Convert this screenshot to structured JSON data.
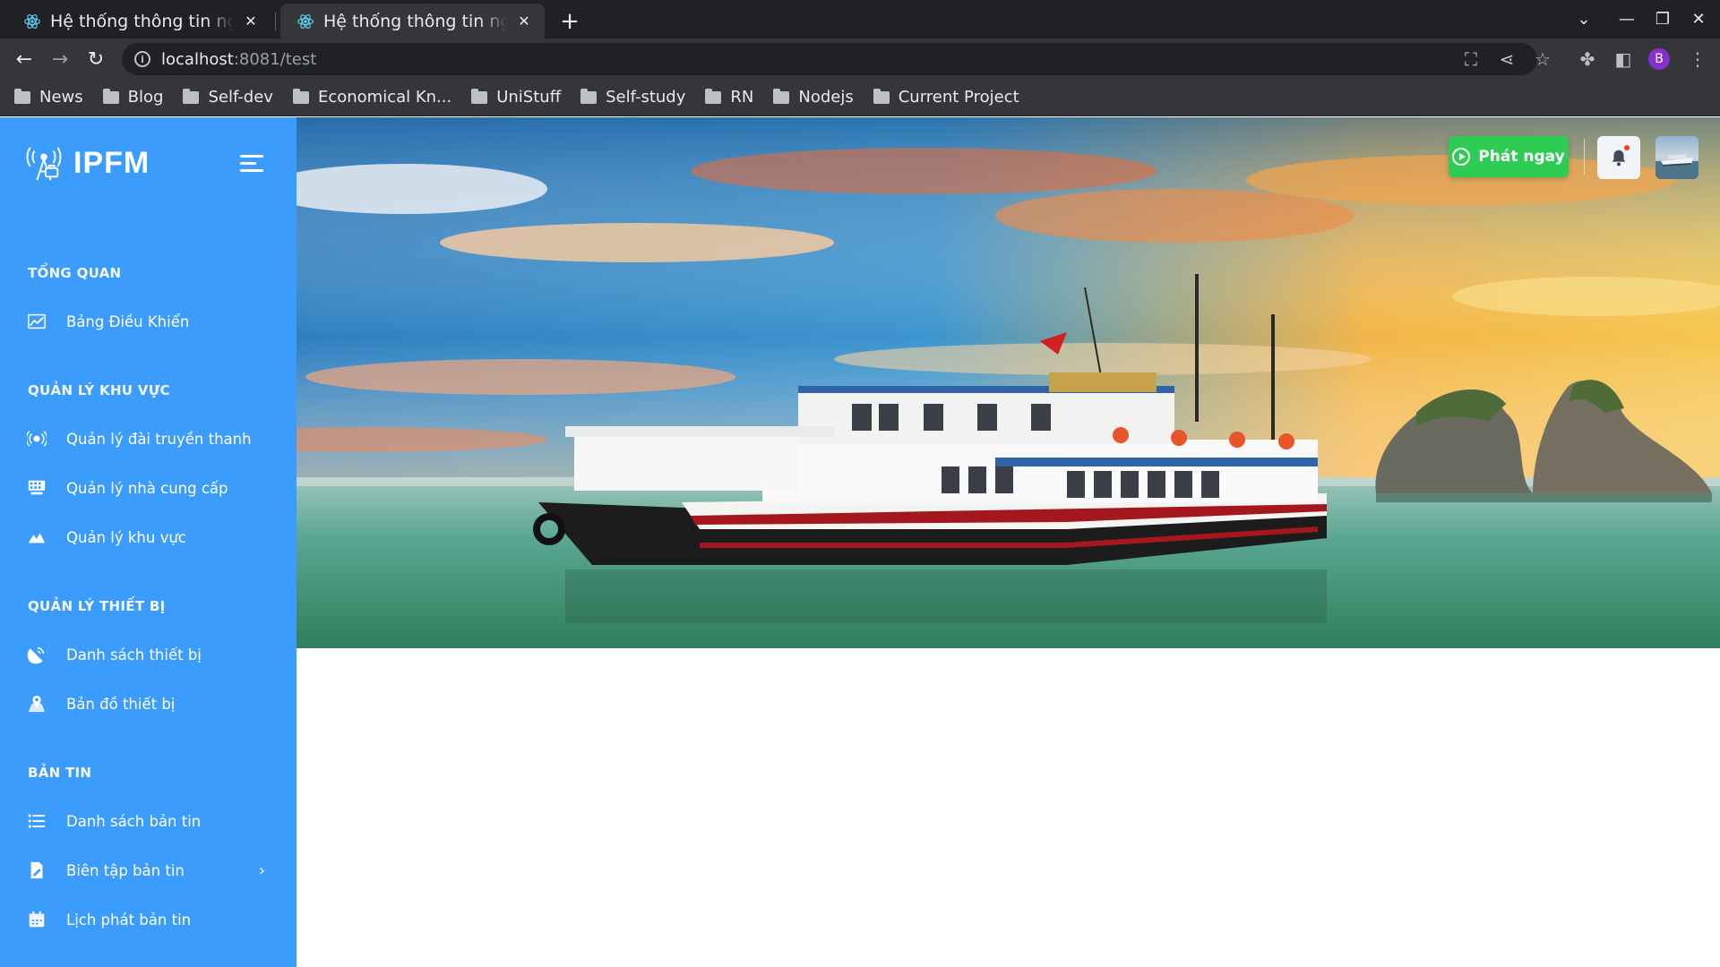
{
  "browser": {
    "tabs": [
      {
        "title": "Hệ thống thông tin nguồn",
        "active": false,
        "icon": "react-icon"
      },
      {
        "title": "Hệ thống thông tin nguồn",
        "active": true,
        "icon": "react-icon"
      }
    ],
    "new_tab": "+",
    "url_host": "localhost",
    "url_path": ":8081/test",
    "profile_initial": "B",
    "bookmarks": [
      "News",
      "Blog",
      "Self-dev",
      "Economical Kn...",
      "UniStuff",
      "Self-study",
      "RN",
      "Nodejs",
      "Current Project"
    ]
  },
  "sidebar": {
    "brand": "IPFM",
    "sections": [
      {
        "title": "TỔNG QUAN",
        "items": [
          {
            "label": "Bảng Điều Khiển",
            "icon": "chart-line-icon"
          }
        ]
      },
      {
        "title": "QUẢN LÝ KHU VỰC",
        "items": [
          {
            "label": "Quản lý đài truyền thanh",
            "icon": "radio-station-icon"
          },
          {
            "label": "Quản lý nhà cung cấp",
            "icon": "provider-icon"
          },
          {
            "label": "Quản lý khu vực",
            "icon": "area-icon"
          }
        ]
      },
      {
        "title": "QUẢN LÝ THIẾT BỊ",
        "items": [
          {
            "label": "Danh sách thiết bị",
            "icon": "satellite-dish-icon"
          },
          {
            "label": "Bản đồ thiết bị",
            "icon": "map-pin-icon"
          }
        ]
      },
      {
        "title": "BẢN TIN",
        "items": [
          {
            "label": "Danh sách bản tin",
            "icon": "list-icon"
          },
          {
            "label": "Biên tập bản tin",
            "icon": "edit-document-icon"
          },
          {
            "label": "Lịch phát bản tin",
            "icon": "calendar-icon"
          }
        ]
      }
    ]
  },
  "header": {
    "play_label": "Phát ngay",
    "colors": {
      "sidebar": "#3b9cfb",
      "play_button": "#2ecc52"
    }
  }
}
